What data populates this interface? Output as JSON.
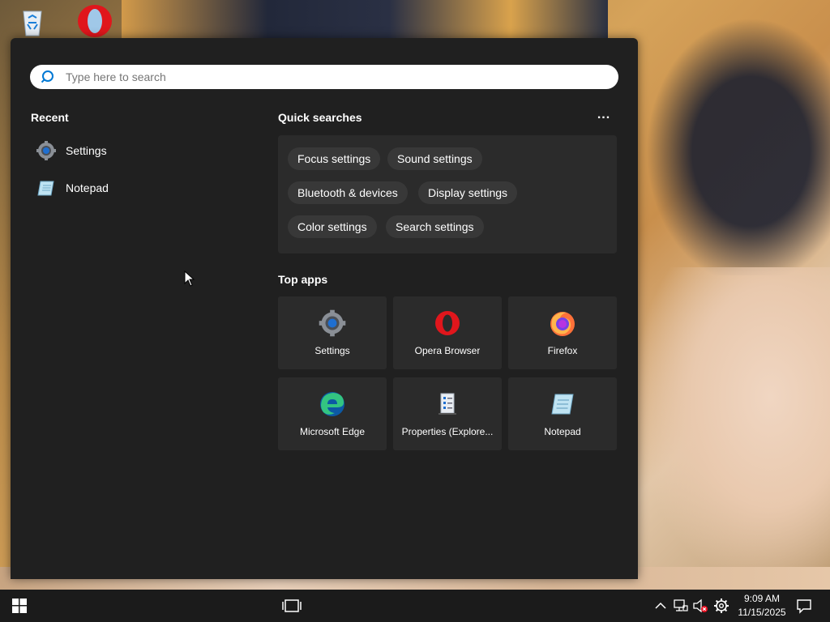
{
  "search": {
    "placeholder": "Type here to search"
  },
  "recent": {
    "title": "Recent",
    "items": [
      {
        "label": "Settings",
        "icon": "settings-gear-icon"
      },
      {
        "label": "Notepad",
        "icon": "notepad-icon"
      }
    ]
  },
  "quick_searches": {
    "title": "Quick searches",
    "more": "...",
    "chips": [
      "Focus settings",
      "Sound settings",
      "Bluetooth & devices",
      "Display settings",
      "Color settings",
      "Search settings"
    ]
  },
  "top_apps": {
    "title": "Top apps",
    "apps": [
      {
        "label": "Settings",
        "icon": "settings-gear-icon"
      },
      {
        "label": "Opera Browser",
        "icon": "opera-icon"
      },
      {
        "label": "Firefox",
        "icon": "firefox-icon"
      },
      {
        "label": "Microsoft Edge",
        "icon": "edge-icon"
      },
      {
        "label": "Properties (Explore...",
        "icon": "properties-icon"
      },
      {
        "label": "Notepad",
        "icon": "notepad-icon"
      }
    ]
  },
  "taskbar": {
    "time": "9:09 AM",
    "date": "11/15/2025"
  },
  "colors": {
    "panel": "#202020",
    "tile": "#2b2b2b",
    "chip": "#383838",
    "taskbar": "#1b1b1b",
    "accent_blue": "#0078d4",
    "opera_red": "#e0161c"
  }
}
